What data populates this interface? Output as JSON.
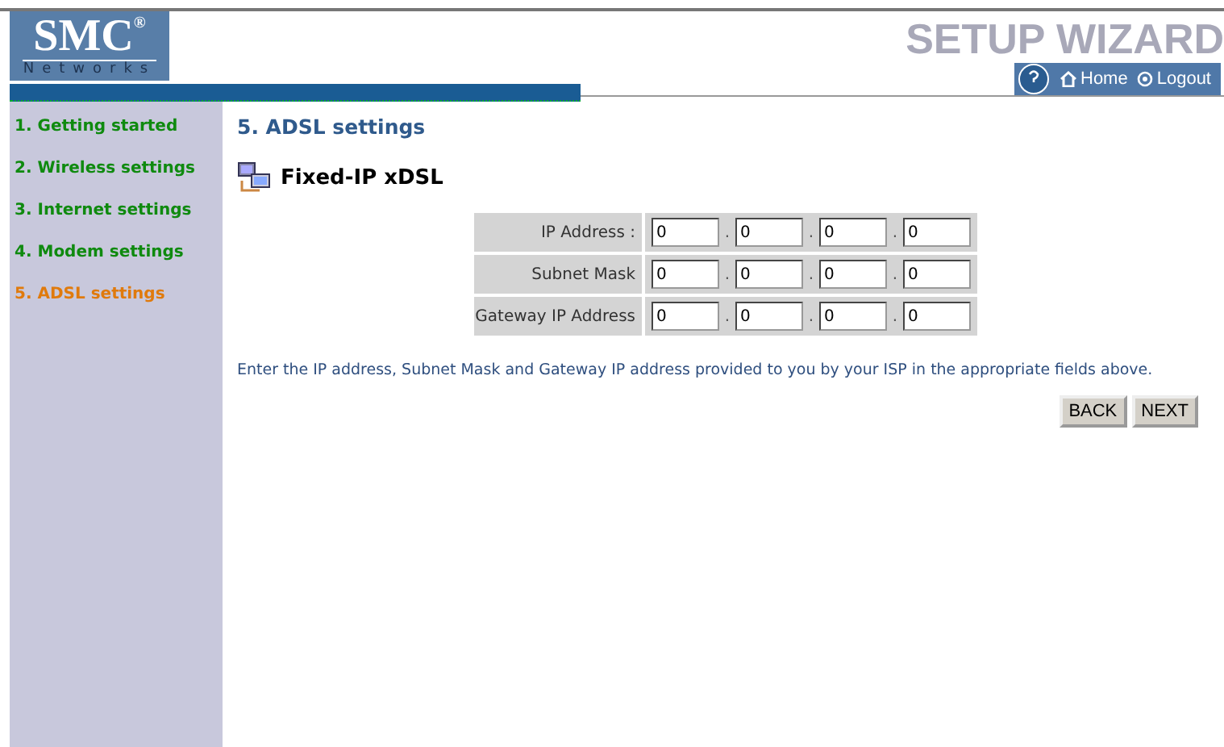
{
  "logo": {
    "brand": "SMC",
    "mark": "®",
    "subtitle": "Networks"
  },
  "header": {
    "title": "SETUP WIZARD",
    "links": [
      {
        "label": "Home",
        "kind": "home"
      },
      {
        "label": "Logout",
        "kind": "logout"
      }
    ]
  },
  "sidebar": {
    "items": [
      {
        "label": "1. Getting started",
        "selected": false
      },
      {
        "label": "2. Wireless settings",
        "selected": false
      },
      {
        "label": "3. Internet settings",
        "selected": false
      },
      {
        "label": "4. Modem settings",
        "selected": false
      },
      {
        "label": "5. ADSL settings",
        "selected": true
      }
    ]
  },
  "page": {
    "title": "5. ADSL settings",
    "subtitle": "Fixed-IP xDSL",
    "rows": [
      {
        "label": "IP Address :",
        "octets": [
          "0",
          "0",
          "0",
          "0"
        ]
      },
      {
        "label": "Subnet Mask",
        "octets": [
          "0",
          "0",
          "0",
          "0"
        ]
      },
      {
        "label": "Gateway IP Address",
        "octets": [
          "0",
          "0",
          "0",
          "0"
        ]
      }
    ],
    "separator": ".",
    "hint": "Enter the IP address, Subnet Mask and Gateway IP address provided to you by your ISP in the appropriate fields above.",
    "buttons": [
      "BACK",
      "NEXT"
    ]
  }
}
